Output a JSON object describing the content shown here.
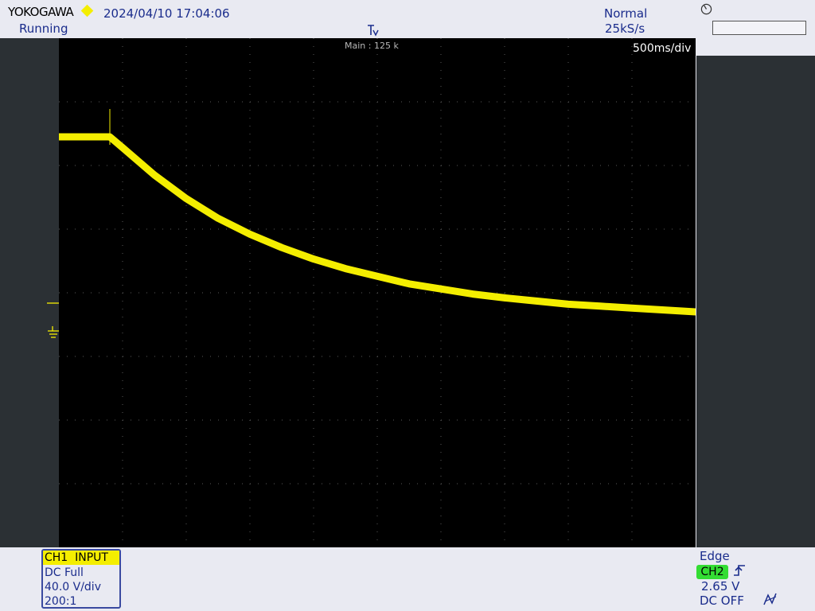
{
  "header": {
    "brand": "YOKOGAWA",
    "datetime": "2024/04/10 17:04:06",
    "status": "Running",
    "acq_mode": "Normal",
    "sample_rate": "25kS/s"
  },
  "right_panel": {
    "input_value": ""
  },
  "screen": {
    "main_label": "Main : 125 k",
    "time_div": "500ms/div"
  },
  "channel": {
    "title": "CH1  INPUT",
    "coupling": "DC Full",
    "vdiv": "40.0 V/div",
    "probe": "200:1",
    "color": "#f4ee00"
  },
  "trigger": {
    "type": "Edge",
    "source": "CH2",
    "level": "2.65 V",
    "coupling": "DC OFF",
    "source_color": "#33dd33"
  },
  "icons": {
    "brand_marker": "diamond-icon",
    "trigger_position": "trigger-position-icon",
    "knob": "rotary-knob-icon",
    "slope": "rising-edge-icon",
    "hf_reject": "hf-reject-icon",
    "ground": "ground-icon"
  },
  "chart_data": {
    "type": "line",
    "grid": true,
    "x_divisions": 10,
    "y_divisions": 8,
    "xlim": [
      0,
      10
    ],
    "ylim": [
      -4,
      4
    ],
    "series": [
      {
        "color": "#f4ee00",
        "x": [
          0,
          0.7,
          0.8,
          1.0,
          1.5,
          2.0,
          2.5,
          3.0,
          3.5,
          4.0,
          4.5,
          5.0,
          5.5,
          6.0,
          6.5,
          7.0,
          7.5,
          8.0,
          8.5,
          9.0,
          9.5,
          10.0
        ],
        "y": [
          2.45,
          2.45,
          2.45,
          2.28,
          1.85,
          1.48,
          1.17,
          0.92,
          0.71,
          0.53,
          0.38,
          0.26,
          0.14,
          0.06,
          -0.02,
          -0.08,
          -0.13,
          -0.18,
          -0.21,
          -0.24,
          -0.27,
          -0.3
        ]
      }
    ]
  }
}
